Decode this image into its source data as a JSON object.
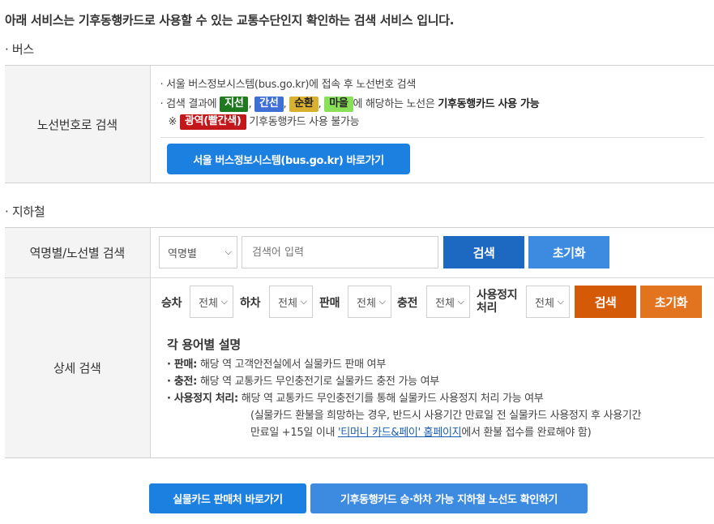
{
  "intro": "아래 서비스는 기후동행카드로 사용할 수 있는 교통수단인지 확인하는 검색 서비스 입니다.",
  "bus": {
    "section_title": "· 버스",
    "row_label": "노선번호로 검색",
    "line1": "· 서울 버스정보시스템(bus.go.kr)에 접속 후 노선번호 검색",
    "line2_prefix": "· 검색 결과에",
    "tags": [
      "지선",
      "간선",
      "순환",
      "마을"
    ],
    "comma": ",",
    "line2_mid": "에 해당하는 노선은",
    "line2_bold": "기후동행카드 사용 가능",
    "line3_prefix": "※",
    "line3_tag": "광역(빨간색)",
    "line3_suffix": "기후동행카드 사용 불가능",
    "button": "서울 버스정보시스템(bus.go.kr) 바로가기",
    "colors": {
      "green": "#1f7a1f",
      "blue": "#3d6fd4",
      "yellow": "#d9b12e",
      "lime": "#8be05a",
      "red": "#c2181b"
    }
  },
  "subway": {
    "section_title": "· 지하철",
    "row1_label": "역명별/노선별 검색",
    "row1_select": "역명별",
    "row1_placeholder": "검색어 입력",
    "row1_search": "검색",
    "row1_reset": "초기화",
    "row2_label": "상세 검색",
    "filters": [
      {
        "label": "승차",
        "value": "전체"
      },
      {
        "label": "하차",
        "value": "전체"
      },
      {
        "label": "판매",
        "value": "전체"
      },
      {
        "label": "충전",
        "value": "전체"
      },
      {
        "label_line1": "사용정지",
        "label_line2": "처리",
        "value": "전체"
      }
    ],
    "row2_search": "검색",
    "row2_reset": "초기화",
    "glossary": {
      "title": "각 용어별 설명",
      "items": [
        {
          "term": "· 판매:",
          "desc": "해당 역 고객안전실에서 실물카드 판매 여부"
        },
        {
          "term": "· 충전:",
          "desc": "해당 역 교통카드 무인충전기로 실물카드 충전 가능 여부"
        },
        {
          "term": "· 사용정지 처리:",
          "desc": "해당 역 교통카드 무인충전기를 통해 실물카드 사용정지 처리 가능 여부"
        }
      ],
      "note_line1": "(실물카드 환불을 희망하는 경우, 반드시 사용기간 만료일 전 실물카드 사용정지 후 사용기간",
      "note_line2_prefix": "만료일 +15일 이내",
      "note_link": "'티머니 카드&페이' 홈페이지",
      "note_line2_suffix": "에서 환불 접수를 완료해야 함)"
    }
  },
  "bottom_buttons": {
    "buy": "실물카드 판매처 바로가기",
    "map": "기후동행카드 승·하차 가능 지하철 노선도 확인하기"
  },
  "icons": {
    "select_chevron": "chevron-down-icon"
  }
}
